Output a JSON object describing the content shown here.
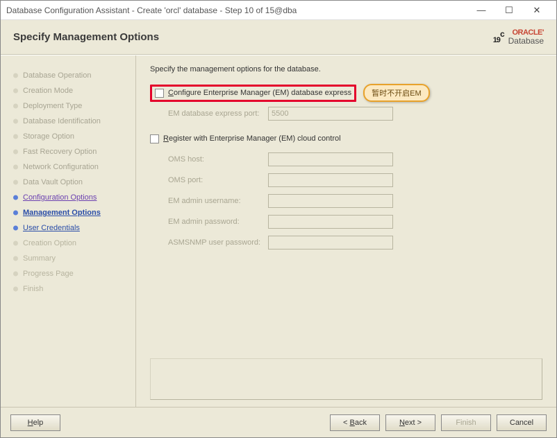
{
  "window": {
    "title": "Database Configuration Assistant - Create 'orcl' database - Step 10 of 15@dba"
  },
  "header": {
    "heading": "Specify Management Options",
    "logo_version": "19",
    "logo_c": "c",
    "logo_brand": "ORACLE'",
    "logo_sub": "Database"
  },
  "nav": {
    "items": [
      {
        "label": "Database Operation",
        "state": "done"
      },
      {
        "label": "Creation Mode",
        "state": "done"
      },
      {
        "label": "Deployment Type",
        "state": "done"
      },
      {
        "label": "Database Identification",
        "state": "done"
      },
      {
        "label": "Storage Option",
        "state": "done"
      },
      {
        "label": "Fast Recovery Option",
        "state": "done"
      },
      {
        "label": "Network Configuration",
        "state": "done"
      },
      {
        "label": "Data Vault Option",
        "state": "done"
      },
      {
        "label": "Configuration Options",
        "state": "link-visited"
      },
      {
        "label": "Management Options",
        "state": "current"
      },
      {
        "label": "User Credentials",
        "state": "link"
      },
      {
        "label": "Creation Option",
        "state": "pending"
      },
      {
        "label": "Summary",
        "state": "pending"
      },
      {
        "label": "Progress Page",
        "state": "pending"
      },
      {
        "label": "Finish",
        "state": "pending"
      }
    ]
  },
  "content": {
    "instruction": "Specify the management options for the database.",
    "em_express_label": "Configure Enterprise Manager (EM) database express",
    "annotation": "暂时不开启EM",
    "em_port_label": "EM database express port:",
    "em_port_value": "5500",
    "register_label": "Register with Enterprise Manager (EM) cloud control",
    "oms_host_label": "OMS host:",
    "oms_host_value": "",
    "oms_port_label": "OMS port:",
    "oms_port_value": "",
    "em_admin_user_label": "EM admin username:",
    "em_admin_user_value": "",
    "em_admin_pass_label": "EM admin password:",
    "em_admin_pass_value": "",
    "asmsnmp_label": "ASMSNMP user password:",
    "asmsnmp_value": ""
  },
  "footer": {
    "help": "Help",
    "back": "< Back",
    "next": "Next >",
    "finish": "Finish",
    "cancel": "Cancel"
  }
}
